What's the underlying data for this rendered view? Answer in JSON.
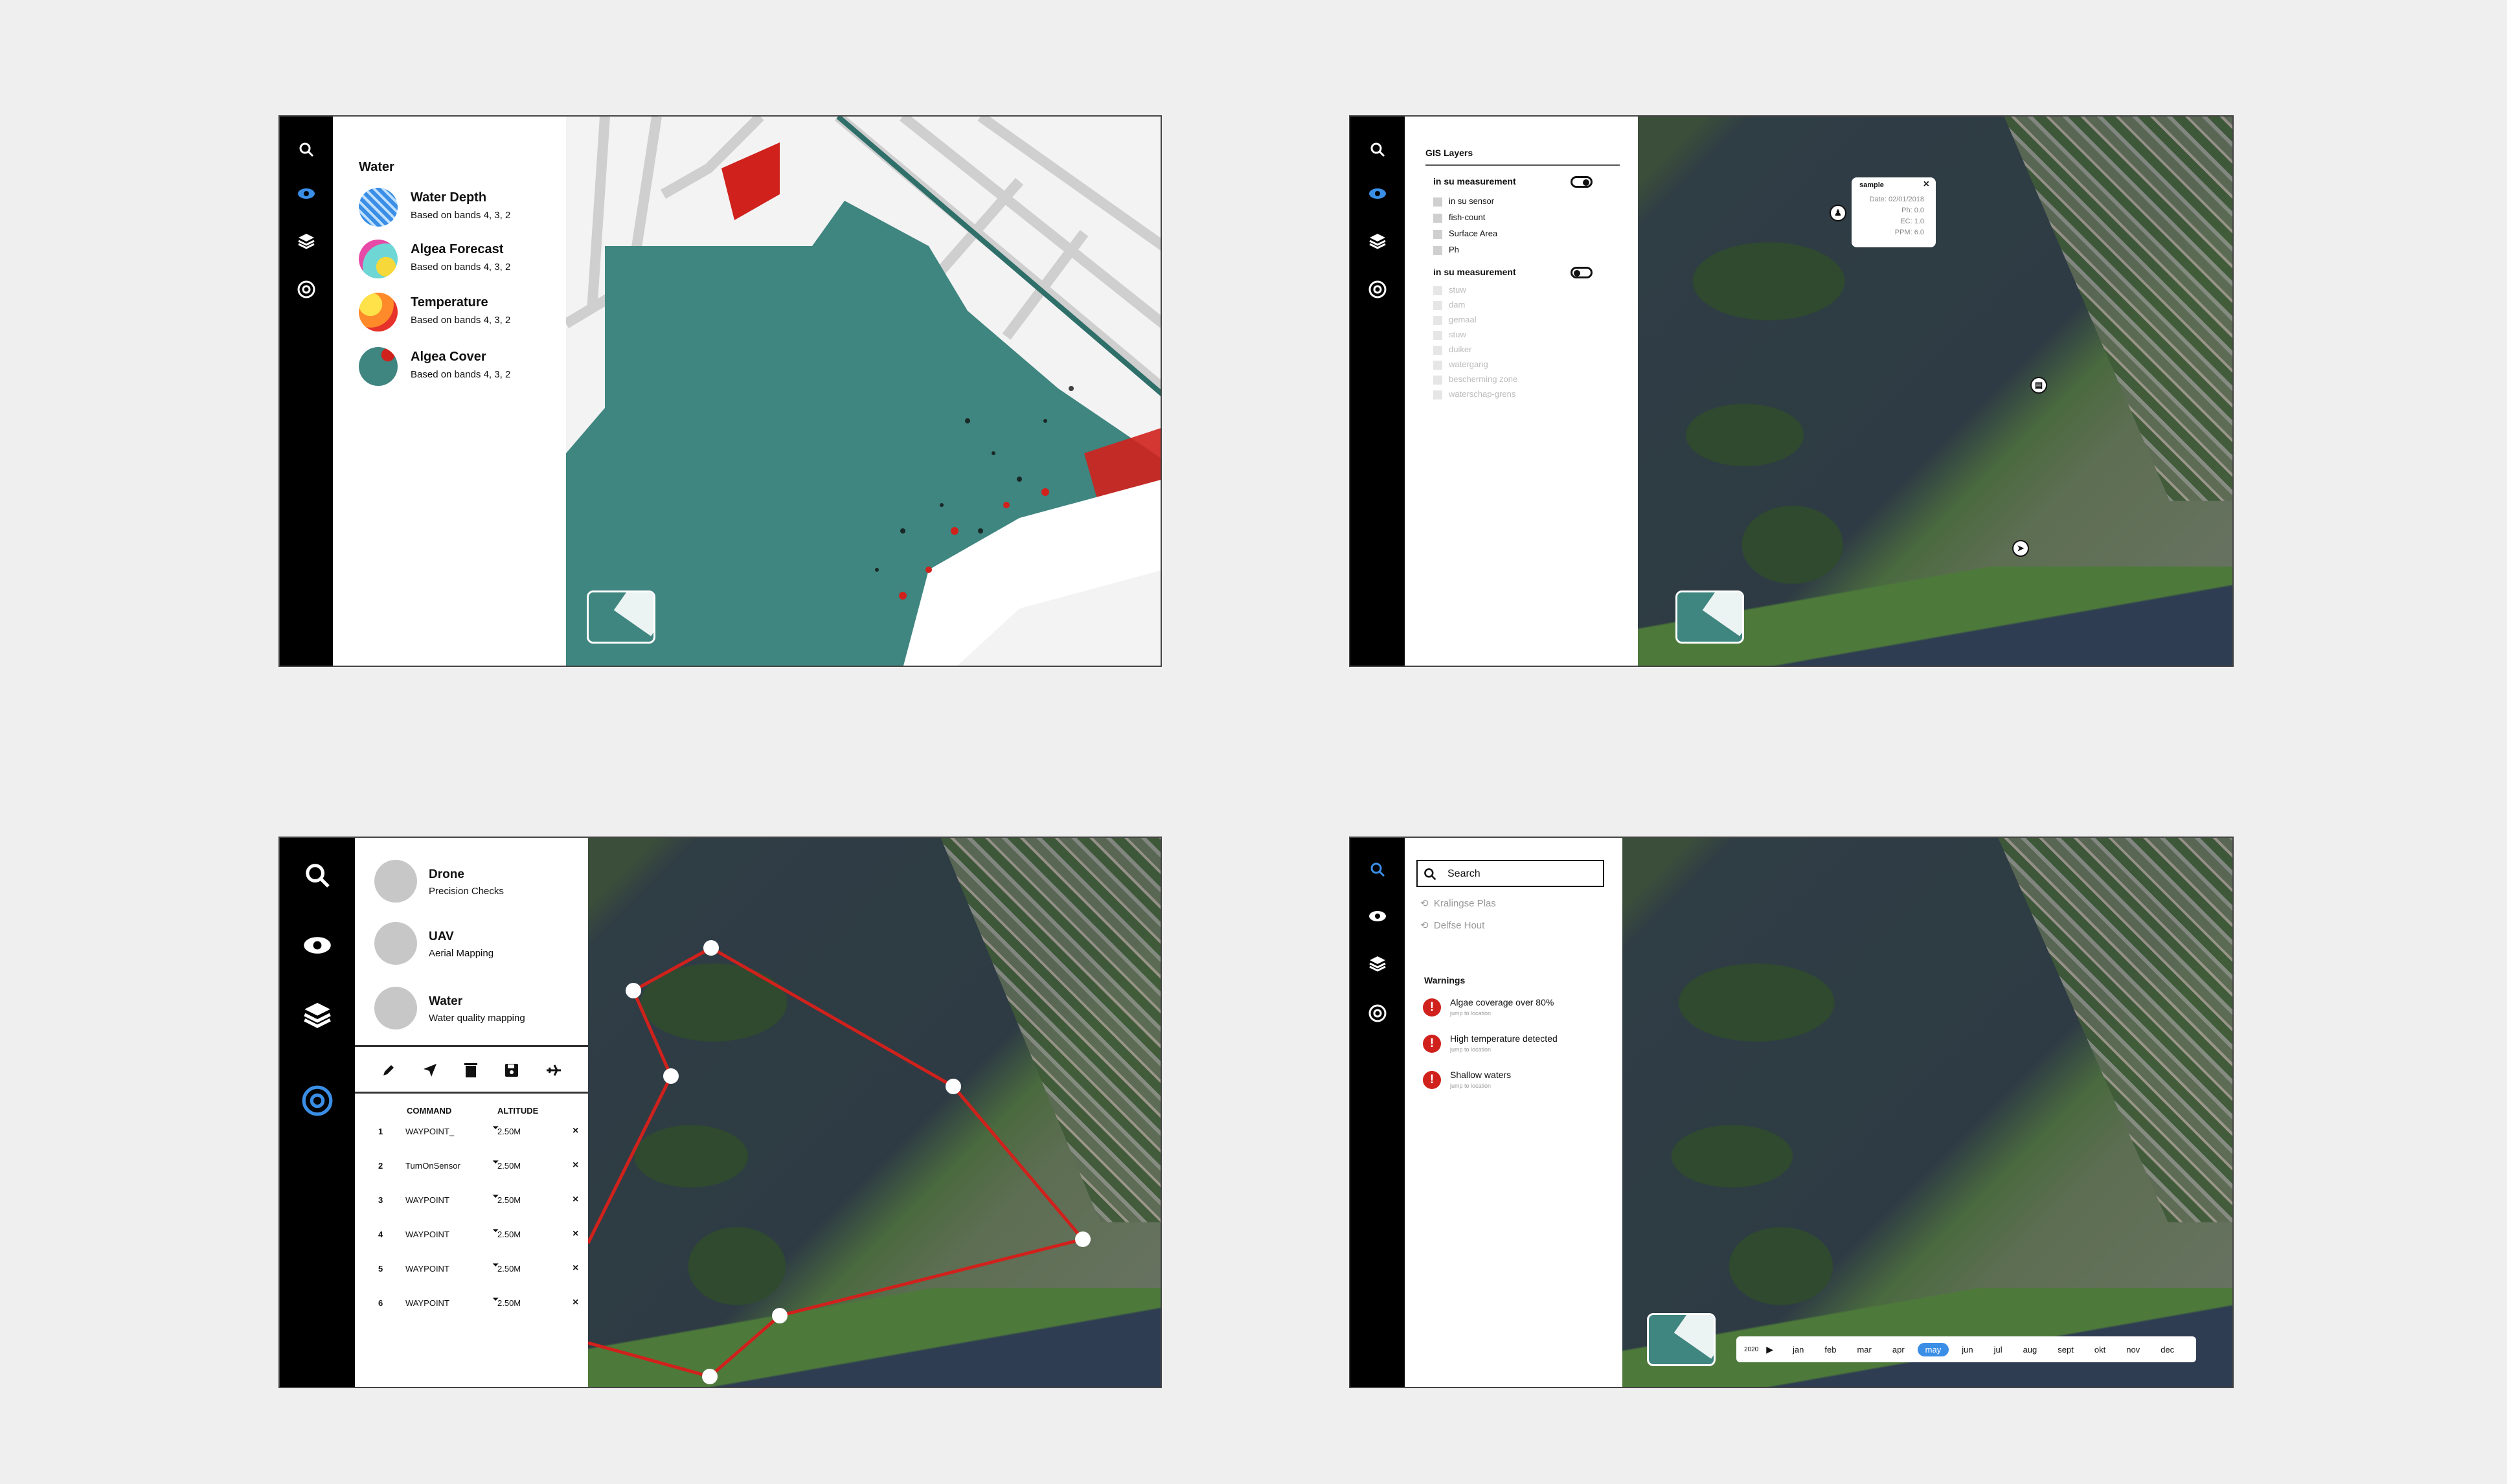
{
  "colors": {
    "accent": "#3a8ee6",
    "water_teal": "#3f8580",
    "route_red": "#d0211c",
    "warning_red": "#d0211c"
  },
  "panel1": {
    "nav": [
      "search-icon",
      "eye-icon",
      "layers-icon",
      "target-icon"
    ],
    "section_title": "Water",
    "layers": [
      {
        "name": "Water Depth",
        "sub": "Based on bands 4, 3, 2",
        "icon": "water-depth-icon"
      },
      {
        "name": "Algea Forecast",
        "sub": "Based on bands 4, 3, 2",
        "icon": "algea-forecast-icon"
      },
      {
        "name": "Temperature",
        "sub": "Based on bands 4, 3, 2",
        "icon": "temperature-icon"
      },
      {
        "name": "Algea Cover",
        "sub": "Based on bands 4, 3, 2",
        "icon": "algea-cover-icon"
      }
    ]
  },
  "panel2": {
    "title": "GIS Layers",
    "group1": {
      "title": "in su measurement",
      "on": true,
      "items": [
        "in su sensor",
        "fish-count",
        "Surface Area",
        "Ph"
      ]
    },
    "group2": {
      "title": "in su measurement",
      "on": false,
      "items": [
        "stuw",
        "dam",
        "gemaal",
        "stuw",
        "duiker",
        "watergang",
        "bescherming zone",
        "waterschap-grens"
      ]
    },
    "popup": {
      "title": "sample",
      "close": "×",
      "lines": [
        "Date: 02/01/2018",
        "Ph: 0.0",
        "EC: 1.0",
        "PPM: 6.0"
      ]
    }
  },
  "panel3": {
    "vehicles": [
      {
        "name": "Drone",
        "sub": "Precision Checks"
      },
      {
        "name": "UAV",
        "sub": "Aerial Mapping"
      },
      {
        "name": "Water",
        "sub": "Water quality mapping"
      }
    ],
    "toolbar": [
      "pencil-icon",
      "navigate-icon",
      "trash-icon",
      "save-icon",
      "plane-icon"
    ],
    "table": {
      "headers": [
        "COMMAND",
        "ALTITUDE"
      ],
      "rows": [
        {
          "n": "1",
          "cmd": "WAYPOINT_",
          "alt": "2.50M"
        },
        {
          "n": "2",
          "cmd": "TurnOnSensor",
          "alt": "2.50M"
        },
        {
          "n": "3",
          "cmd": "WAYPOINT",
          "alt": "2.50M"
        },
        {
          "n": "4",
          "cmd": "WAYPOINT",
          "alt": "2.50M"
        },
        {
          "n": "5",
          "cmd": "WAYPOINT",
          "alt": "2.50M"
        },
        {
          "n": "6",
          "cmd": "WAYPOINT",
          "alt": "2.50M"
        }
      ],
      "delete": "×"
    }
  },
  "panel4": {
    "search": {
      "value": "Search"
    },
    "recent": [
      "Kralingse Plas",
      "Delfse Hout"
    ],
    "warnings_title": "Warnings",
    "warnings": [
      {
        "text": "Algae coverage over 80%",
        "link": "jump to location"
      },
      {
        "text": "High temperature detected",
        "link": "jump to location"
      },
      {
        "text": "Shallow waters",
        "link": "jump to location"
      }
    ],
    "timeline": {
      "year": "2020",
      "play": "▶",
      "months": [
        "jan",
        "feb",
        "mar",
        "apr",
        "may",
        "jun",
        "jul",
        "aug",
        "sept",
        "okt",
        "nov",
        "dec"
      ],
      "selected": "may"
    }
  }
}
